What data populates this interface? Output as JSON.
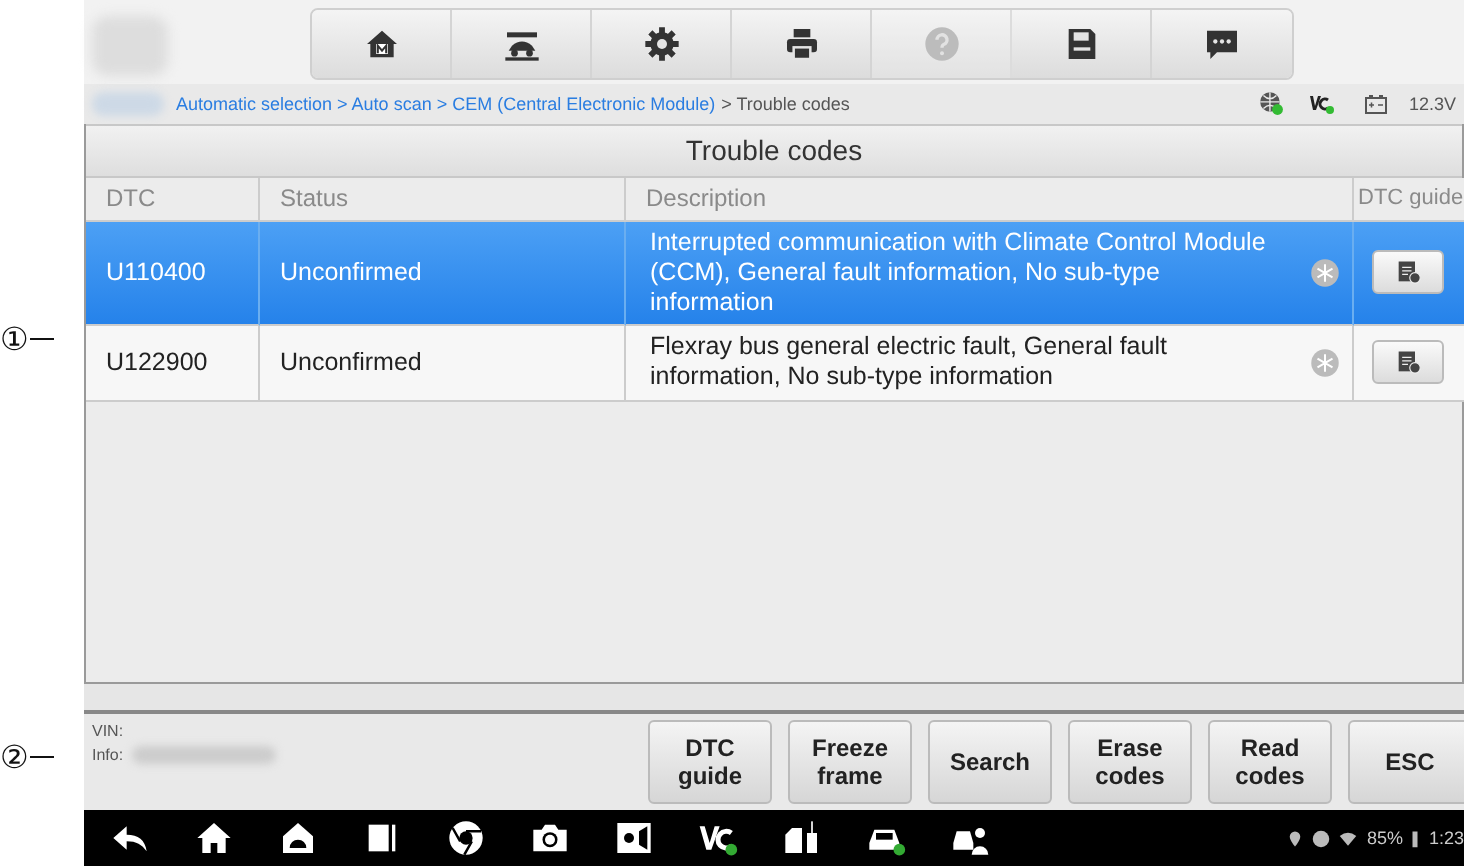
{
  "callouts": [
    {
      "label": "①"
    },
    {
      "label": "②"
    }
  ],
  "toolbar": [
    {
      "kind": "home",
      "disabled": false
    },
    {
      "kind": "lift",
      "disabled": false
    },
    {
      "kind": "settings",
      "disabled": false
    },
    {
      "kind": "print",
      "disabled": false
    },
    {
      "kind": "help",
      "disabled": true
    },
    {
      "kind": "save",
      "disabled": false
    },
    {
      "kind": "message",
      "disabled": false
    }
  ],
  "breadcrumb": {
    "path": "Automatic selection > Auto scan > CEM (Central Electronic Module)",
    "current": "> Trouble codes"
  },
  "status": {
    "voltage": "12.3V"
  },
  "table": {
    "title": "Trouble codes",
    "columns": [
      "DTC",
      "Status",
      "Description",
      "DTC guide"
    ],
    "rows": [
      {
        "dtc": "U110400",
        "status": "Unconfirmed",
        "description": "Interrupted communication with Climate Control Module (CCM), General fault information, No sub-type information",
        "selected": true
      },
      {
        "dtc": "U122900",
        "status": "Unconfirmed",
        "description": "Flexray bus general electric fault, General fault information, No sub-type information",
        "selected": false
      }
    ]
  },
  "info": {
    "vin_label": "VIN:",
    "info_label": "Info:"
  },
  "buttons": [
    "DTC guide",
    "Freeze frame",
    "Search",
    "Erase codes",
    "Read codes",
    "ESC"
  ],
  "nav": [
    {
      "kind": "back"
    },
    {
      "kind": "home"
    },
    {
      "kind": "android"
    },
    {
      "kind": "recent"
    },
    {
      "kind": "chrome"
    },
    {
      "kind": "camera"
    },
    {
      "kind": "brightness"
    },
    {
      "kind": "vci"
    },
    {
      "kind": "pump"
    },
    {
      "kind": "car"
    },
    {
      "kind": "mechanic"
    }
  ],
  "system": {
    "battery": "85%",
    "time": "1:23"
  }
}
